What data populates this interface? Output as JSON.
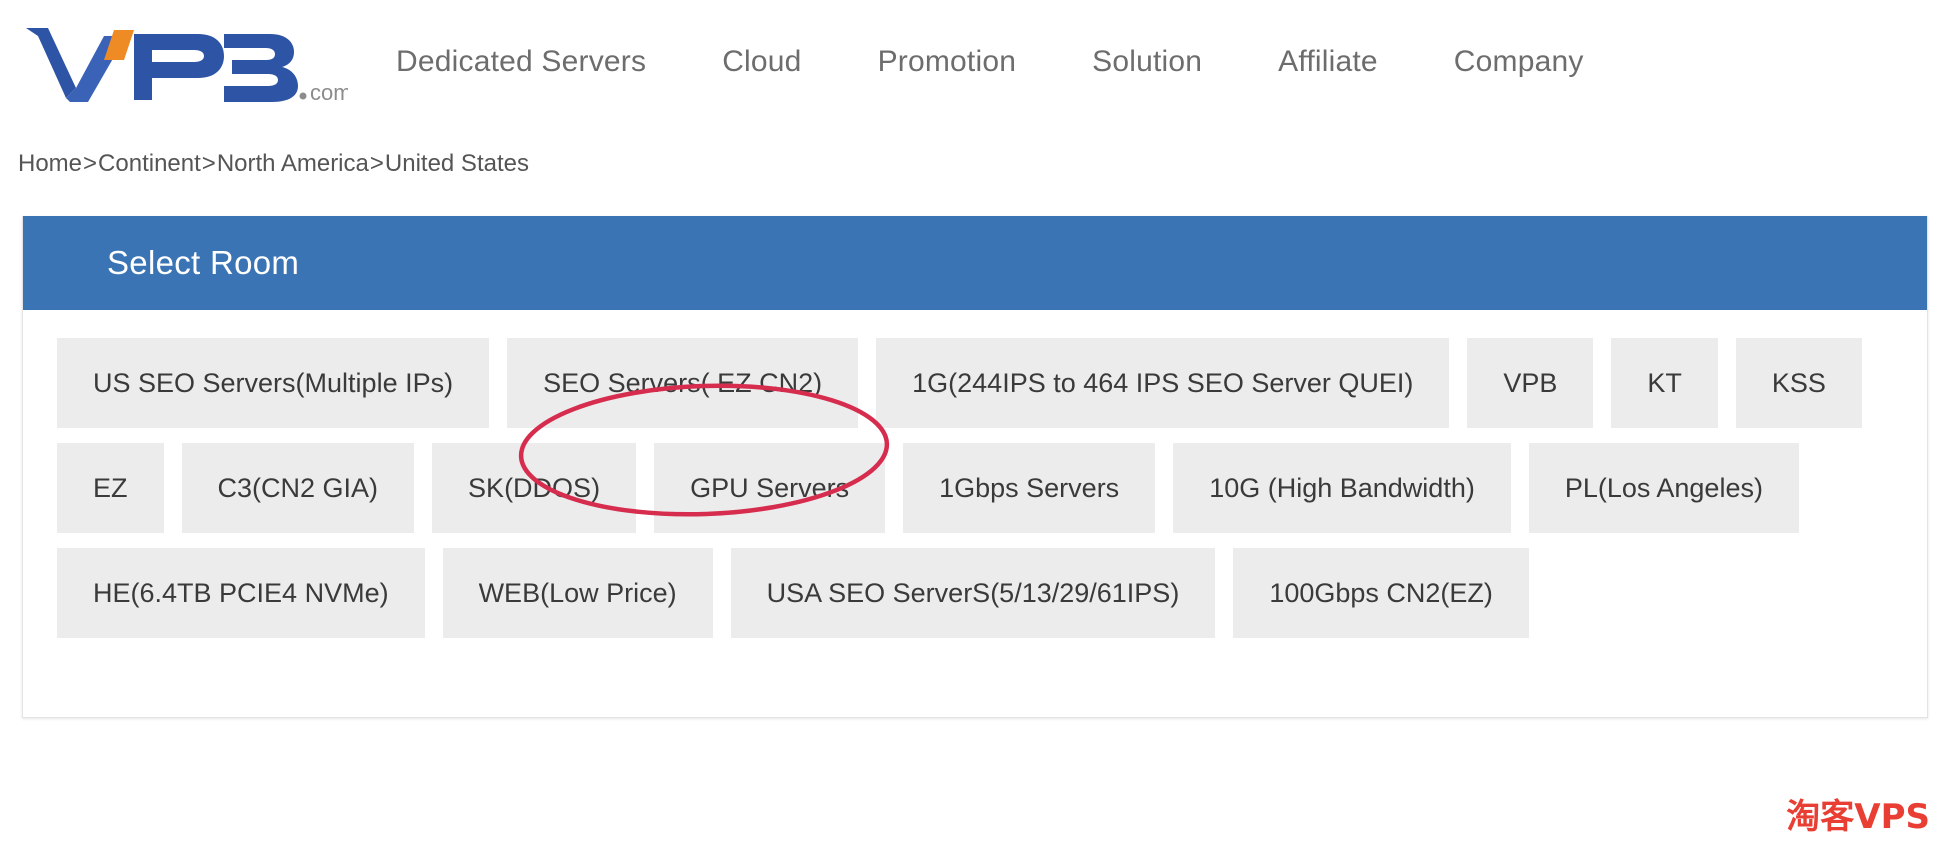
{
  "header": {
    "logo": {
      "text": "VPB",
      "suffix": ".com",
      "primary_color": "#2e55a5",
      "accent_color": "#ef8b24",
      "suffix_color": "#8c8c8c",
      "alt": "VPB.com logo"
    },
    "nav": [
      {
        "label": "Dedicated Servers"
      },
      {
        "label": "Cloud"
      },
      {
        "label": "Promotion"
      },
      {
        "label": "Solution"
      },
      {
        "label": "Affiliate"
      },
      {
        "label": "Company"
      }
    ]
  },
  "breadcrumb": {
    "separator": ">",
    "items": [
      {
        "label": "Home"
      },
      {
        "label": "Continent"
      },
      {
        "label": "North America"
      },
      {
        "label": "United States"
      }
    ]
  },
  "panel": {
    "title": "Select Room",
    "header_color": "#3b74b5",
    "rows": [
      [
        {
          "label": "US SEO Servers(Multiple IPs)"
        },
        {
          "label": "SEO Servers( EZ CN2)"
        },
        {
          "label": "1G(244IPS to 464 IPS SEO Server QUEI)"
        },
        {
          "label": "VPB"
        },
        {
          "label": "KT"
        },
        {
          "label": "KSS"
        }
      ],
      [
        {
          "label": "EZ"
        },
        {
          "label": "C3(CN2 GIA)"
        },
        {
          "label": "SK(DDOS)"
        },
        {
          "label": "GPU Servers"
        },
        {
          "label": "1Gbps Servers"
        },
        {
          "label": "10G (High Bandwidth)"
        },
        {
          "label": "PL(Los Angeles)"
        }
      ],
      [
        {
          "label": "HE(6.4TB PCIE4 NVMe)"
        },
        {
          "label": "WEB(Low Price)"
        },
        {
          "label": "USA SEO ServerS(5/13/29/61IPS)"
        },
        {
          "label": "100Gbps CN2(EZ)"
        }
      ]
    ]
  },
  "annotation": {
    "type": "ellipse",
    "color": "#d62c4e",
    "targets": "SEO Servers( EZ CN2)"
  },
  "watermark": {
    "text": "淘客VPS",
    "color": "#e8342a"
  }
}
